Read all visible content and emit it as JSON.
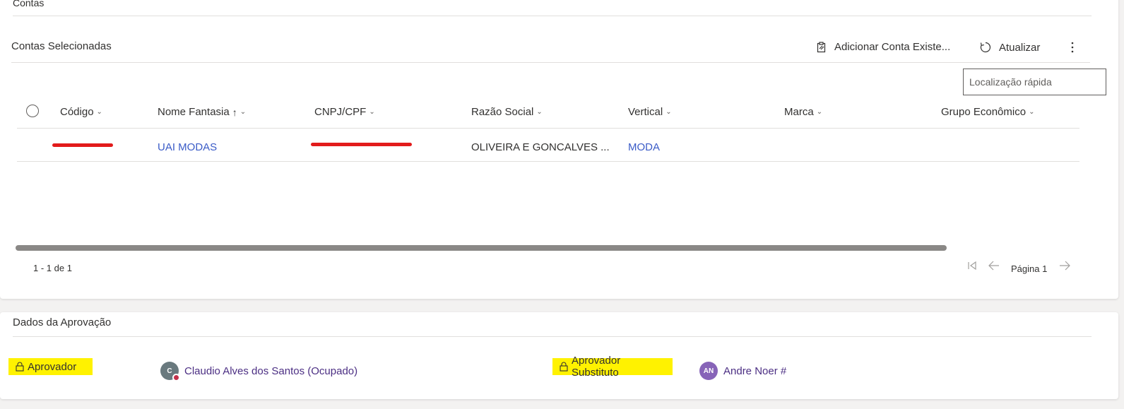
{
  "section_contas": {
    "title": "Contas"
  },
  "grid": {
    "title": "Contas Selecionadas",
    "commands": {
      "add_existing": "Adicionar Conta Existe...",
      "refresh": "Atualizar",
      "more_icon": "more-vertical-icon"
    },
    "quick_find_placeholder": "Localização rápida",
    "columns": [
      "Código",
      "Nome Fantasia",
      "CNPJ/CPF",
      "Razão Social",
      "Vertical",
      "Marca",
      "Grupo Econômico"
    ],
    "sort_indicator": "↑",
    "rows": [
      {
        "codigo": "",
        "nome_fantasia": "UAI MODAS",
        "cnpj_cpf": "",
        "razao_social": "OLIVEIRA E GONCALVES ...",
        "vertical": "MODA",
        "marca": "",
        "grupo_economico": ""
      }
    ],
    "record_count": "1 - 1 de 1",
    "page_label": "Página 1"
  },
  "section_aprovacao": {
    "title": "Dados da Aprovação",
    "approver": {
      "label": "Aprovador",
      "avatar_initials": "C",
      "name": "Claudio Alves dos Santos (Ocupado)",
      "avatar_color": "#69797e",
      "presence_color": "#c4314b"
    },
    "substitute": {
      "label": "Aprovador Substituto",
      "avatar_initials": "AN",
      "name": "Andre Noer #",
      "avatar_color": "#8764b8"
    }
  },
  "colors": {
    "link": "#3a5bc7",
    "highlight": "#fff200",
    "redaction": "#e21b1b"
  }
}
